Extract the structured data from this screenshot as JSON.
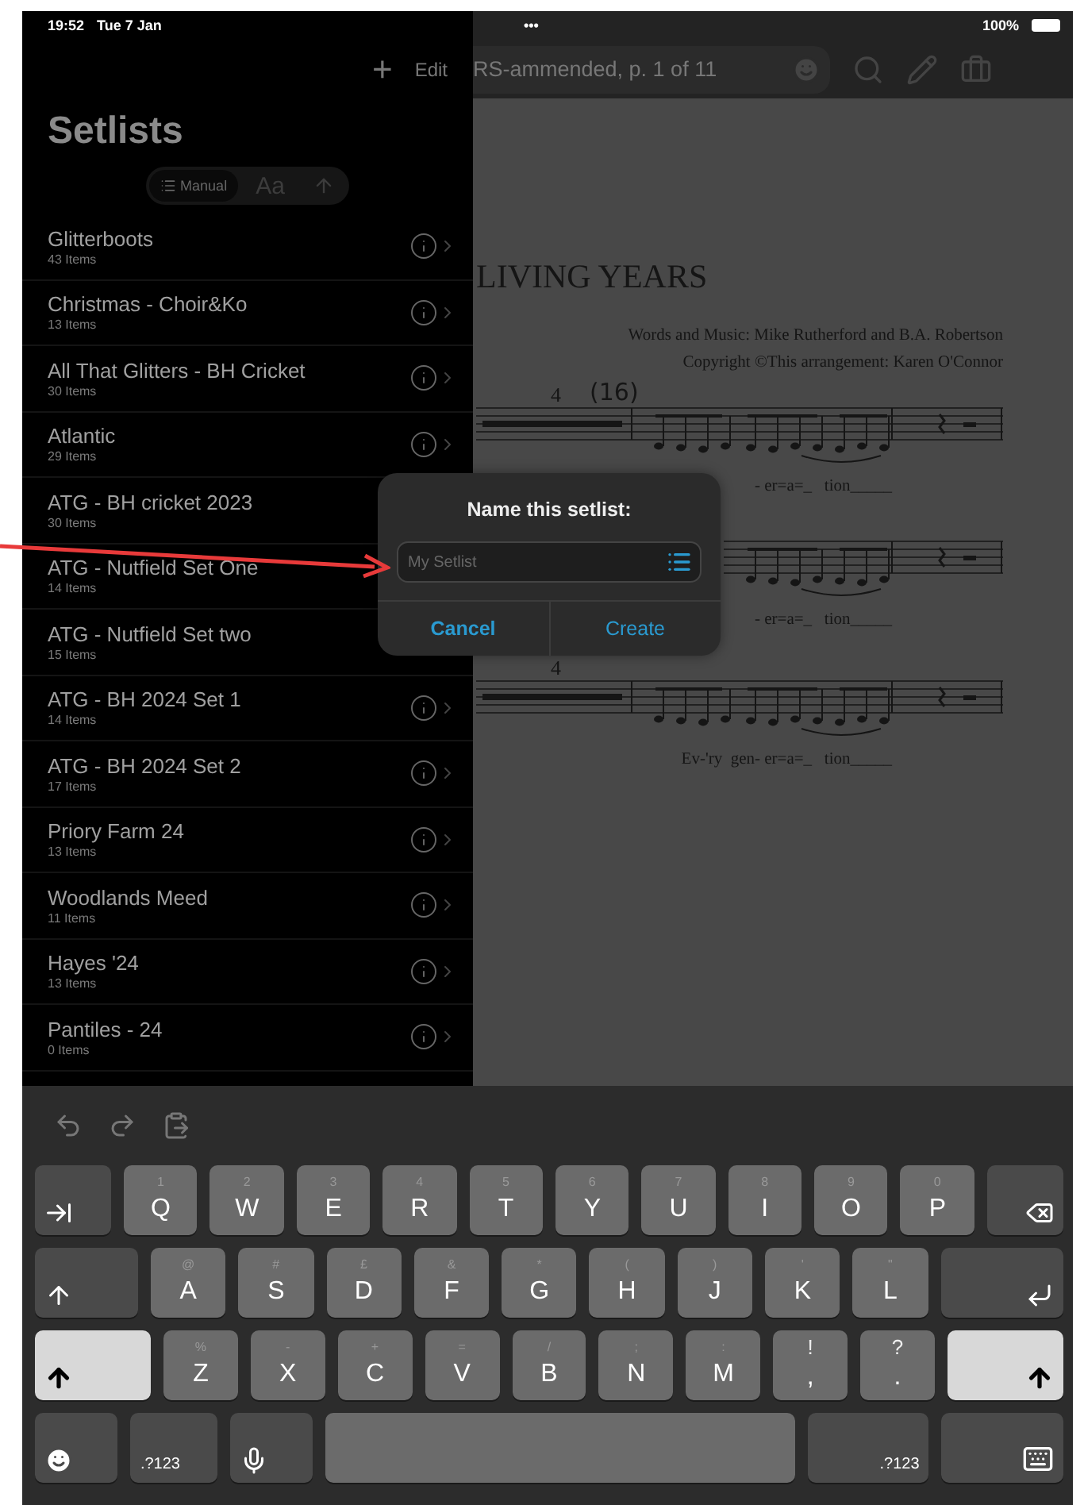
{
  "status_bar": {
    "time": "19:52",
    "date": "Tue 7 Jan",
    "more": "•••",
    "battery": "100%"
  },
  "sidebar": {
    "add_button": "+",
    "edit_button": "Edit",
    "title": "Setlists",
    "sort_options": [
      {
        "kind": "list",
        "label": "Manual",
        "selected": true
      },
      {
        "kind": "alpha",
        "label": "Aa",
        "selected": false
      },
      {
        "kind": "arrow",
        "selected": false
      }
    ],
    "setlists": [
      {
        "name": "Glitterboots",
        "count": "43 Items"
      },
      {
        "name": "Christmas - Choir&Ko",
        "count": "13 Items"
      },
      {
        "name": "All That Glitters - BH Cricket",
        "count": "30 Items"
      },
      {
        "name": "Atlantic",
        "count": "29 Items"
      },
      {
        "name": "ATG - BH cricket 2023",
        "count": "30 Items"
      },
      {
        "name": "ATG - Nutfield Set One",
        "count": "14 Items"
      },
      {
        "name": "ATG - Nutfield Set two",
        "count": "15 Items"
      },
      {
        "name": "ATG - BH 2024 Set 1",
        "count": "14 Items"
      },
      {
        "name": "ATG - BH 2024 Set 2",
        "count": "17 Items"
      },
      {
        "name": "Priory Farm 24",
        "count": "13 Items"
      },
      {
        "name": "Woodlands Meed",
        "count": "11 Items"
      },
      {
        "name": "Hayes '24",
        "count": "13 Items"
      },
      {
        "name": "Pantiles - 24",
        "count": "0 Items"
      }
    ]
  },
  "document": {
    "title": "RS-ammended, p. 1 of 11",
    "song_title": "LIVING YEARS",
    "credits": "Words and Music: Mike Rutherford and B.A. Robertson",
    "copyright": "Copyright ©This arrangement: Karen O'Connor",
    "staves": [
      {
        "rest_count": "4",
        "rehearsal_mark": "(16)",
        "lyrics": "- er=a=_   tion_____"
      },
      {
        "lyrics": "- er=a=_   tion_____"
      },
      {
        "rest_count": "4",
        "lyrics": "Ev-'ry  gen- er=a=_   tion_____"
      }
    ]
  },
  "dialog": {
    "title": "Name this setlist:",
    "placeholder": "My Setlist",
    "buttons": [
      {
        "kind": "cancel",
        "label": "Cancel"
      },
      {
        "kind": "confirm",
        "label": "Create"
      }
    ]
  },
  "keyboard": {
    "rows": [
      [
        {
          "kind": "tab"
        },
        {
          "kind": "letter",
          "label": "Q",
          "alt": "1"
        },
        {
          "kind": "letter",
          "label": "W",
          "alt": "2"
        },
        {
          "kind": "letter",
          "label": "E",
          "alt": "3"
        },
        {
          "kind": "letter",
          "label": "R",
          "alt": "4"
        },
        {
          "kind": "letter",
          "label": "T",
          "alt": "5"
        },
        {
          "kind": "letter",
          "label": "Y",
          "alt": "6"
        },
        {
          "kind": "letter",
          "label": "U",
          "alt": "7"
        },
        {
          "kind": "letter",
          "label": "I",
          "alt": "8"
        },
        {
          "kind": "letter",
          "label": "O",
          "alt": "9"
        },
        {
          "kind": "letter",
          "label": "P",
          "alt": "0"
        },
        {
          "kind": "backspace"
        }
      ],
      [
        {
          "kind": "caps"
        },
        {
          "kind": "letter",
          "label": "A",
          "alt": "@"
        },
        {
          "kind": "letter",
          "label": "S",
          "alt": "#"
        },
        {
          "kind": "letter",
          "label": "D",
          "alt": "£"
        },
        {
          "kind": "letter",
          "label": "F",
          "alt": "&"
        },
        {
          "kind": "letter",
          "label": "G",
          "alt": "*"
        },
        {
          "kind": "letter",
          "label": "H",
          "alt": "("
        },
        {
          "kind": "letter",
          "label": "J",
          "alt": ")"
        },
        {
          "kind": "letter",
          "label": "K",
          "alt": "'"
        },
        {
          "kind": "letter",
          "label": "L",
          "alt": "\""
        },
        {
          "kind": "return"
        }
      ],
      [
        {
          "kind": "shift",
          "active": true
        },
        {
          "kind": "letter",
          "label": "Z",
          "alt": "%"
        },
        {
          "kind": "letter",
          "label": "X",
          "alt": "-"
        },
        {
          "kind": "letter",
          "label": "C",
          "alt": "+"
        },
        {
          "kind": "letter",
          "label": "V",
          "alt": "="
        },
        {
          "kind": "letter",
          "label": "B",
          "alt": "/"
        },
        {
          "kind": "letter",
          "label": "N",
          "alt": ";"
        },
        {
          "kind": "letter",
          "label": "M",
          "alt": ":"
        },
        {
          "kind": "punct",
          "label": ",",
          "alt": "!"
        },
        {
          "kind": "punct",
          "label": ".",
          "alt": "?"
        },
        {
          "kind": "shift",
          "active": true
        }
      ]
    ],
    "bottom_row": [
      {
        "kind": "emoji"
      },
      {
        "kind": "numbers",
        "label": ".?123"
      },
      {
        "kind": "mic"
      },
      {
        "kind": "space"
      },
      {
        "kind": "numbers",
        "label": ".?123"
      },
      {
        "kind": "hide"
      }
    ]
  }
}
